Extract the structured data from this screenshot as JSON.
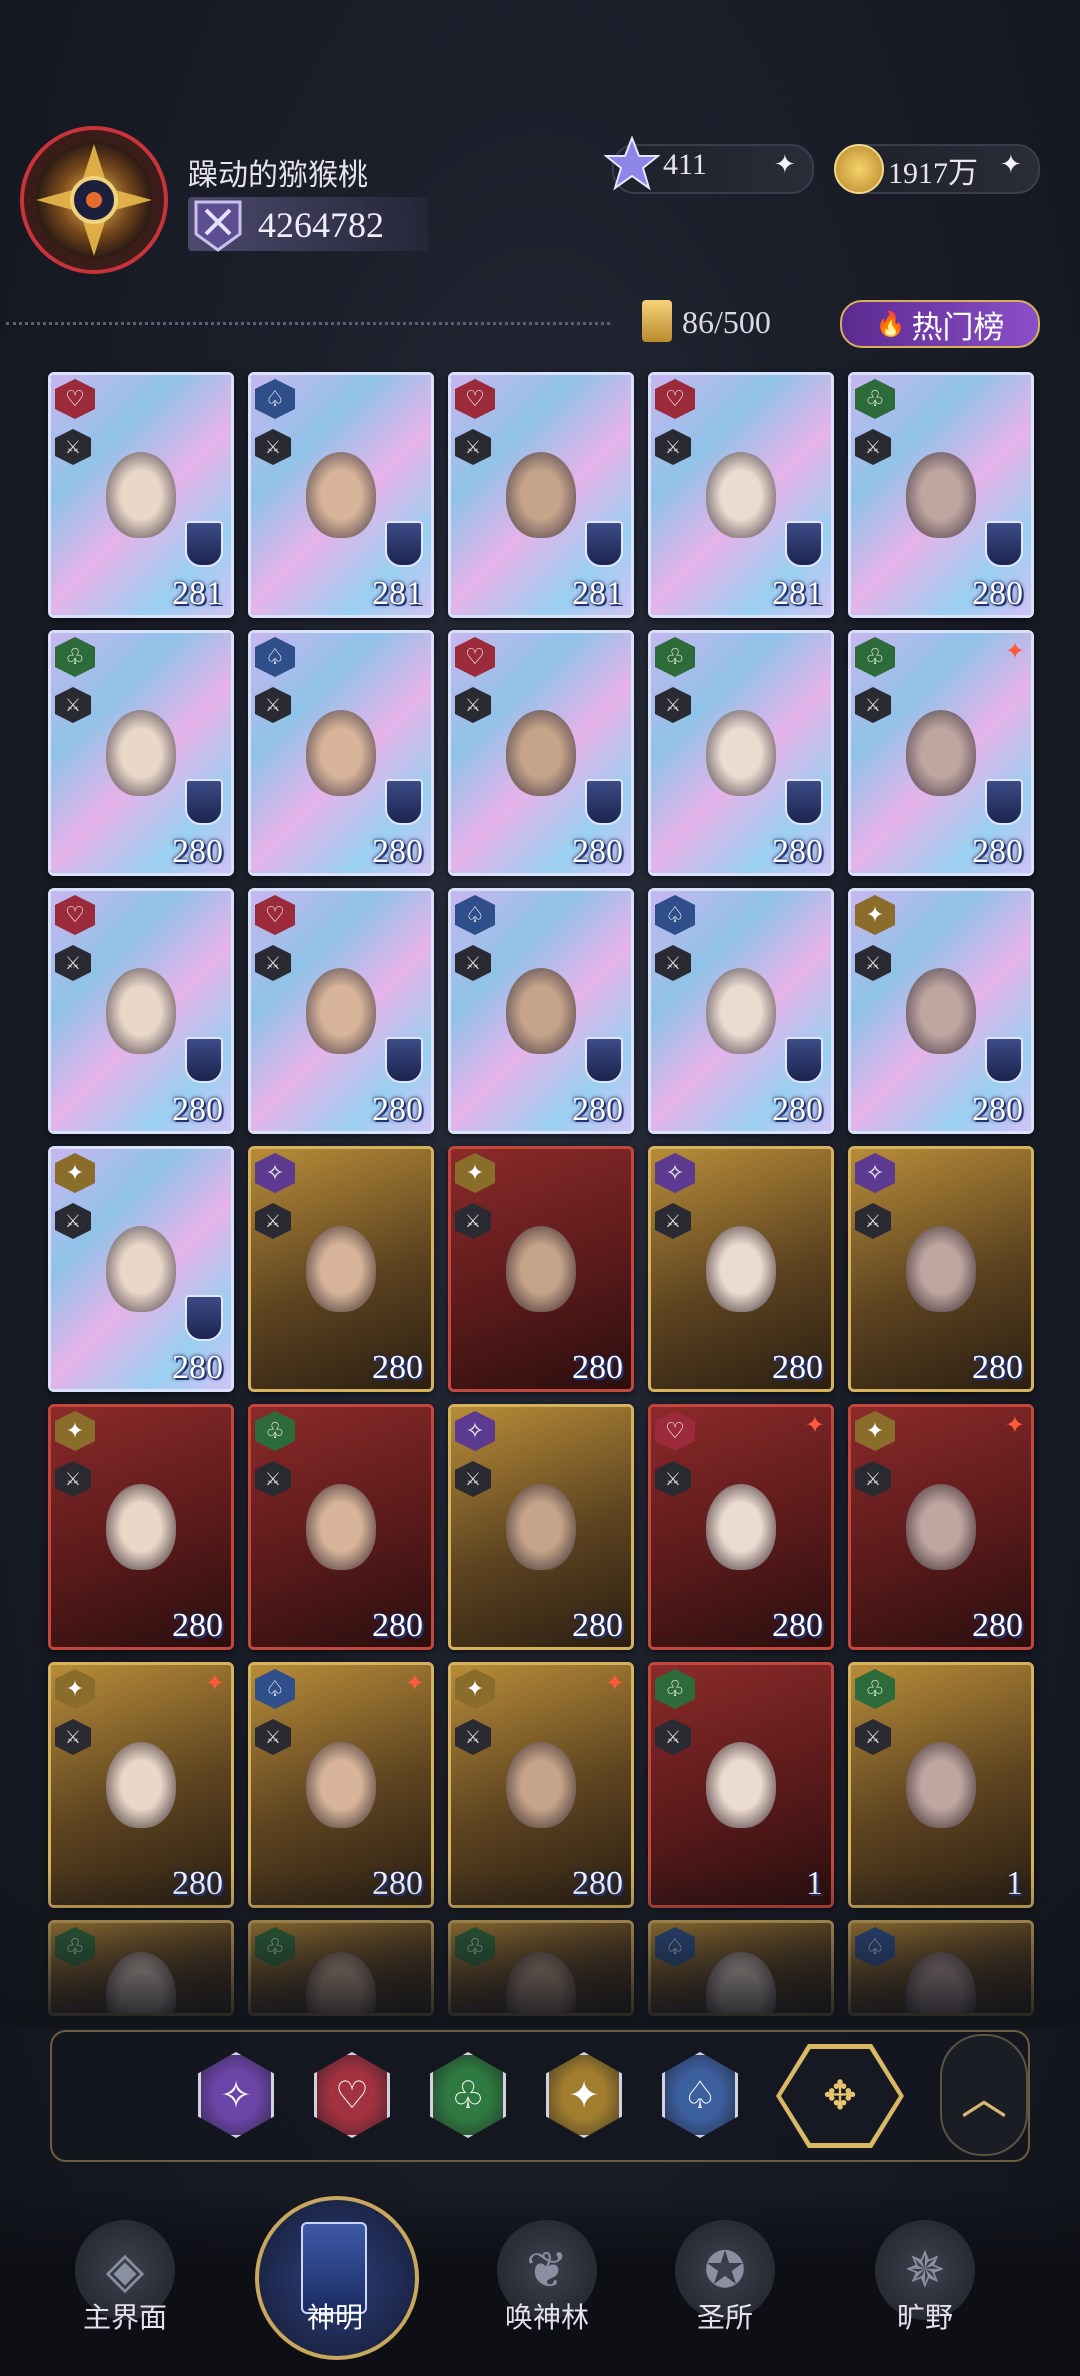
{
  "header": {
    "username": "躁动的猕猴桃",
    "power": "4264782",
    "gems": "411",
    "gold": "1917万",
    "plus_glyph": "✦",
    "card_count": "86/500",
    "hot_button_label": "热门榜",
    "hot_icon": "🔥"
  },
  "cards": [
    {
      "faction": "heart",
      "level": "281",
      "frame": "holo"
    },
    {
      "faction": "spade",
      "level": "281",
      "frame": "holo"
    },
    {
      "faction": "heart",
      "level": "281",
      "frame": "holo"
    },
    {
      "faction": "heart",
      "level": "281",
      "frame": "holo"
    },
    {
      "faction": "club",
      "level": "280",
      "frame": "holo"
    },
    {
      "faction": "club",
      "level": "280",
      "frame": "holo"
    },
    {
      "faction": "spade",
      "level": "280",
      "frame": "holo"
    },
    {
      "faction": "heart",
      "level": "280",
      "frame": "holo"
    },
    {
      "faction": "club",
      "level": "280",
      "frame": "holo"
    },
    {
      "faction": "club",
      "level": "280",
      "frame": "holo",
      "star": true
    },
    {
      "faction": "heart",
      "level": "280",
      "frame": "holo"
    },
    {
      "faction": "heart",
      "level": "280",
      "frame": "holo"
    },
    {
      "faction": "spade",
      "level": "280",
      "frame": "holo"
    },
    {
      "faction": "spade",
      "level": "280",
      "frame": "holo"
    },
    {
      "faction": "light",
      "level": "280",
      "frame": "holo"
    },
    {
      "faction": "light",
      "level": "280",
      "frame": "holo"
    },
    {
      "faction": "star",
      "level": "280",
      "frame": "gold"
    },
    {
      "faction": "light",
      "level": "280",
      "frame": "red"
    },
    {
      "faction": "star",
      "level": "280",
      "frame": "gold"
    },
    {
      "faction": "star",
      "level": "280",
      "frame": "gold"
    },
    {
      "faction": "light",
      "level": "280",
      "frame": "red"
    },
    {
      "faction": "club",
      "level": "280",
      "frame": "red"
    },
    {
      "faction": "star",
      "level": "280",
      "frame": "gold"
    },
    {
      "faction": "heart",
      "level": "280",
      "frame": "red",
      "star": true
    },
    {
      "faction": "light",
      "level": "280",
      "frame": "red",
      "star": true
    },
    {
      "faction": "light",
      "level": "280",
      "frame": "gold",
      "star": true
    },
    {
      "faction": "spade",
      "level": "280",
      "frame": "gold",
      "star": true
    },
    {
      "faction": "light",
      "level": "280",
      "frame": "gold",
      "star": true
    },
    {
      "faction": "club",
      "level": "1",
      "frame": "red"
    },
    {
      "faction": "club",
      "level": "1",
      "frame": "gold"
    },
    {
      "faction": "club",
      "level": "",
      "frame": "gold"
    },
    {
      "faction": "club",
      "level": "",
      "frame": "gold"
    },
    {
      "faction": "club",
      "level": "",
      "frame": "gold"
    },
    {
      "faction": "spade",
      "level": "",
      "frame": "gold"
    },
    {
      "faction": "spade",
      "level": "",
      "frame": "gold"
    }
  ],
  "faction_colors": {
    "heart": "#9b2a3a",
    "spade": "#2f4f8a",
    "club": "#2e6b3a",
    "light": "#8a6d2a",
    "star": "#5b3a8f"
  },
  "faction_glyphs": {
    "heart": "♡",
    "spade": "♤",
    "club": "♧",
    "light": "✦",
    "star": "✧"
  },
  "filter": {
    "items": [
      {
        "name": "filter-star-icon",
        "glyph": "✧",
        "color": "#6b45a8"
      },
      {
        "name": "filter-heart-icon",
        "glyph": "♡",
        "color": "#a2323f"
      },
      {
        "name": "filter-club-icon",
        "glyph": "♧",
        "color": "#2f7a40"
      },
      {
        "name": "filter-light-icon",
        "glyph": "✦",
        "color": "#a07e2e"
      },
      {
        "name": "filter-spade-icon",
        "glyph": "♤",
        "color": "#3c5f9e"
      }
    ],
    "all_glyph": "✥",
    "collapse_glyph": "︿"
  },
  "nav": {
    "main_label": "主界面",
    "gods_label": "神明",
    "summon_label": "唤神林",
    "sanctuary_label": "圣所",
    "wild_label": "旷野"
  }
}
